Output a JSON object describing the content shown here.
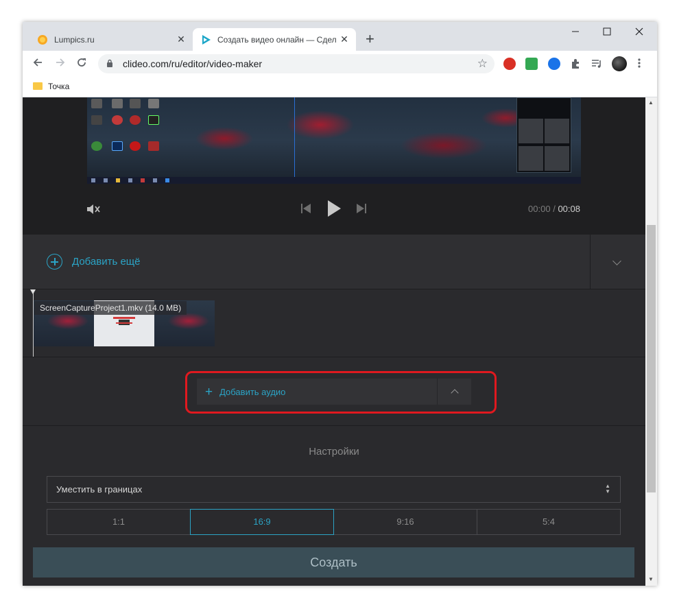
{
  "browser": {
    "tabs": [
      {
        "title": "Lumpics.ru",
        "favicon": "orange-circle-icon",
        "active": false
      },
      {
        "title": "Создать видео онлайн — Сдела",
        "favicon": "clideo-play-icon",
        "active": true
      }
    ],
    "close_symbol": "✕",
    "new_tab_symbol": "+",
    "window_controls": {
      "minimize": "—",
      "maximize": "☐",
      "close": "✕"
    },
    "url": "clideo.com/ru/editor/video-maker",
    "bookmarks": [
      {
        "label": "Точка",
        "icon": "folder-icon"
      }
    ],
    "extension_colors": [
      "#d93025",
      "#34a853",
      "#1a73e8"
    ]
  },
  "player": {
    "time_current": "00:00",
    "time_separator": "/",
    "time_total": "00:08"
  },
  "editor": {
    "add_more_label": "Добавить ещё",
    "clip_label": "ScreenCaptureProject1.mkv (14.0 MB)",
    "add_audio_symbol": "+",
    "add_audio_label": "Добавить аудио"
  },
  "settings": {
    "title": "Настройки",
    "fit_mode": "Уместить в границах",
    "ratios": [
      "1:1",
      "16:9",
      "9:16",
      "5:4"
    ],
    "selected_ratio": "16:9"
  },
  "actions": {
    "create_label": "Создать"
  },
  "colors": {
    "accent": "#2ba4c6",
    "highlight": "#e0191f",
    "create_button": "#3a4e57"
  }
}
